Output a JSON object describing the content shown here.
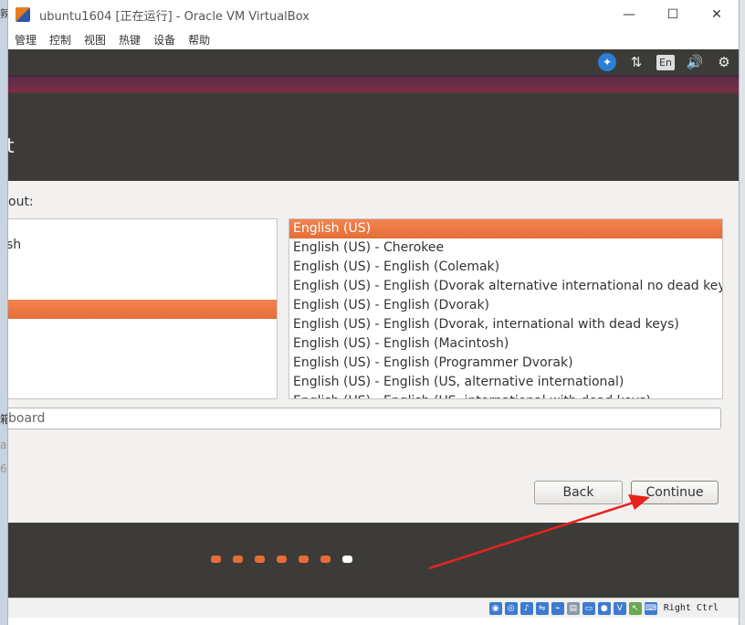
{
  "window": {
    "title": "ubuntu1604 [正在运行] - Oracle VM VirtualBox",
    "minimize": "—",
    "maximize": "☐",
    "close": "✕"
  },
  "menu": [
    "管理",
    "控制",
    "视图",
    "热键",
    "设备",
    "帮助"
  ],
  "topbar": {
    "accessibility_icon": "accessibility-icon",
    "network_icon": "network-icon",
    "language_label": "En",
    "volume_icon": "volume-icon",
    "settings_icon": "gear-icon"
  },
  "installer": {
    "title_fragment": "t",
    "layout_label_fragment": "out:",
    "left_list_fragment": "sh",
    "variants": [
      "English (US)",
      "English (US) - Cherokee",
      "English (US) - English (Colemak)",
      "English (US) - English (Dvorak alternative international no dead keys)",
      "English (US) - English (Dvorak)",
      "English (US) - English (Dvorak, international with dead keys)",
      "English (US) - English (Macintosh)",
      "English (US) - English (Programmer Dvorak)",
      "English (US) - English (US, alternative international)",
      "English (US) - English (US, international with dead keys)"
    ],
    "selected_variant": "English (US)",
    "type_field_fragment": "board",
    "back_label": "Back",
    "continue_label": "Continue",
    "progress": {
      "total_steps": 7,
      "current_step": 7
    }
  },
  "statusbar": {
    "host_key": "Right Ctrl"
  },
  "colors": {
    "accent": "#e46e38",
    "dark": "#3c3b37",
    "annotation": "#e8231c"
  },
  "left_strip_fragments": [
    "辣",
    "箱",
    "a",
    "6"
  ]
}
